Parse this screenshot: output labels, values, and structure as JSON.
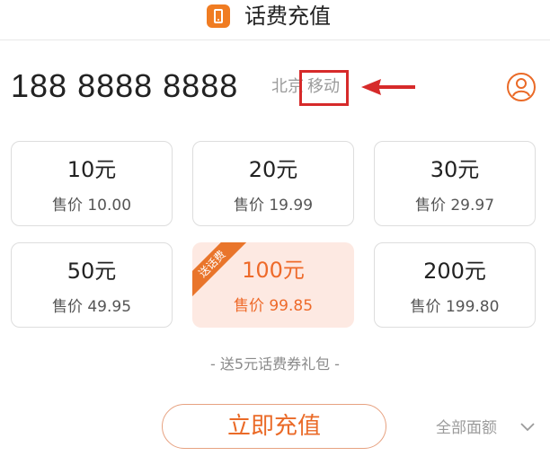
{
  "header": {
    "title": "话费充值",
    "icon": "phone-icon"
  },
  "phone": {
    "number": "188 8888 8888",
    "city": "北京",
    "carrier": "移动"
  },
  "cards": [
    {
      "face": "10元",
      "price": "售价 10.00"
    },
    {
      "face": "20元",
      "price": "售价 19.99"
    },
    {
      "face": "30元",
      "price": "售价 29.97"
    },
    {
      "face": "50元",
      "price": "售价 49.95"
    },
    {
      "face": "100元",
      "price": "售价 99.85",
      "badge": "送话费",
      "selected": true
    },
    {
      "face": "200元",
      "price": "售价 199.80"
    }
  ],
  "gift_text": "- 送5元话费券礼包 -",
  "action": {
    "recharge_label": "立即充值",
    "all_values_label": "全部面额"
  },
  "colors": {
    "accent": "#ee6a2a",
    "highlight_box": "#d62a2a",
    "selected_bg": "#fde9e2"
  }
}
